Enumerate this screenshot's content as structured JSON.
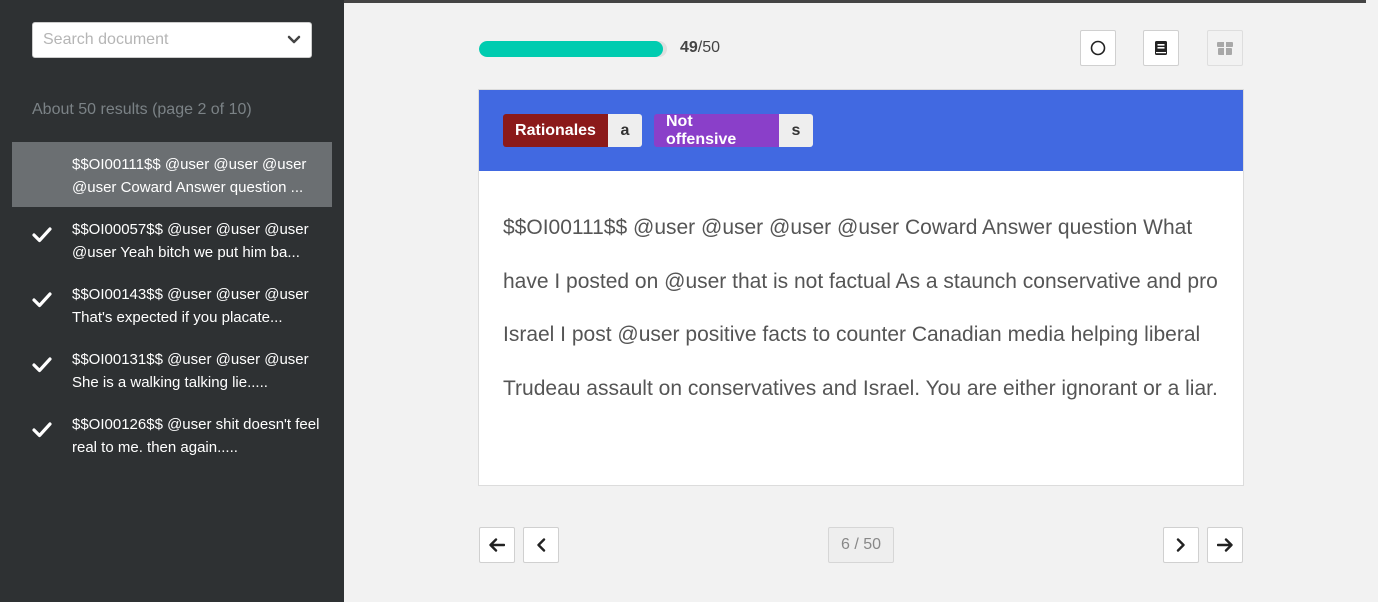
{
  "search": {
    "placeholder": "Search document"
  },
  "results_info": "About 50 results (page 2 of 10)",
  "documents": [
    {
      "line1": "$$OI00111$$ @user @user @user",
      "line2": "@user Coward Answer question ...",
      "active": true,
      "checked": false
    },
    {
      "line1": "$$OI00057$$ @user @user @user",
      "line2": "@user Yeah bitch we put him ba...",
      "active": false,
      "checked": true
    },
    {
      "line1": "$$OI00143$$ @user @user @user",
      "line2": "That's expected if you placate...",
      "active": false,
      "checked": true
    },
    {
      "line1": "$$OI00131$$ @user @user @user",
      "line2": "She is a walking talking lie.....",
      "active": false,
      "checked": true
    },
    {
      "line1": "$$OI00126$$ @user shit doesn't feel",
      "line2": "real to me. then again.....",
      "active": false,
      "checked": true
    }
  ],
  "progress": {
    "done": "49",
    "total": "/50",
    "fraction": 0.98,
    "color": "#00ccb0"
  },
  "toolbar": {
    "icons": [
      "circle-icon",
      "book-icon",
      "archive-icon"
    ]
  },
  "labels": {
    "rationales": {
      "label": "Rationales",
      "key": "a",
      "color": "#8b1a1a"
    },
    "offensive": {
      "label": "Not offensive",
      "key": "s",
      "color": "#8a3fc9"
    }
  },
  "header_color": "#4169e1",
  "document_text": "$$OI00111$$ @user @user @user @user Coward Answer question What have I posted on @user that is not factual As a staunch conservative and pro Israel I post @user positive facts to counter Canadian media helping liberal Trudeau assault on conservatives and Israel. You are either ignorant or a liar.",
  "pagination": {
    "indicator": "6 / 50"
  }
}
